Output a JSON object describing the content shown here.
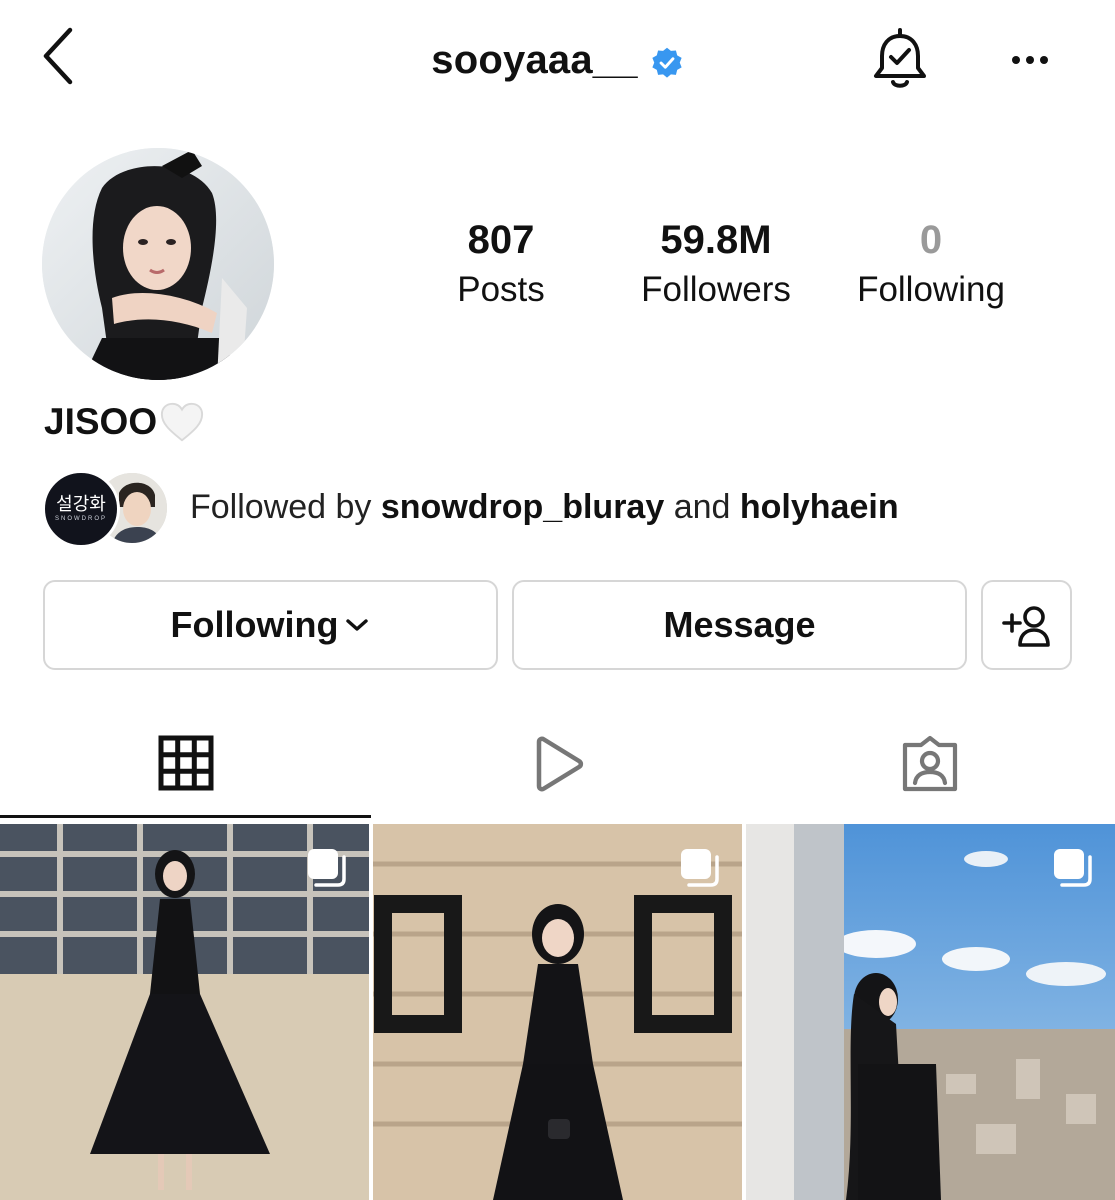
{
  "header": {
    "username": "sooyaaa__",
    "verified": true,
    "back_icon": "chevron-left-icon",
    "bell_icon": "bell-check-icon",
    "more_icon": "more-horizontal-icon"
  },
  "profile": {
    "display_name": "JISOO",
    "name_emoji": "white-heart",
    "stats": {
      "posts": {
        "value": "807",
        "label": "Posts"
      },
      "followers": {
        "value": "59.8M",
        "label": "Followers"
      },
      "following": {
        "value": "0",
        "label": "Following"
      }
    }
  },
  "followed_by": {
    "prefix": "Followed by",
    "user_1": "snowdrop_bluray",
    "conjunction": "and",
    "user_2": "holyhaein",
    "avatar_1_text": "설강화",
    "avatar_1_subtext": "SNOWDROP"
  },
  "actions": {
    "following_label": "Following",
    "message_label": "Message",
    "add_user_icon": "add-user-icon"
  },
  "tabs": [
    {
      "name": "grid",
      "icon": "grid-icon",
      "active": true
    },
    {
      "name": "reels",
      "icon": "play-icon",
      "active": false
    },
    {
      "name": "tagged",
      "icon": "tagged-user-icon",
      "active": false
    }
  ],
  "posts": [
    {
      "type": "carousel",
      "icon": "multiple-photos-icon"
    },
    {
      "type": "carousel",
      "icon": "multiple-photos-icon"
    },
    {
      "type": "carousel",
      "icon": "multiple-photos-icon"
    }
  ],
  "colors": {
    "verified_blue": "#3897f0",
    "border": "#d6d6d6",
    "muted": "#9a9a9a",
    "text": "#111111"
  }
}
